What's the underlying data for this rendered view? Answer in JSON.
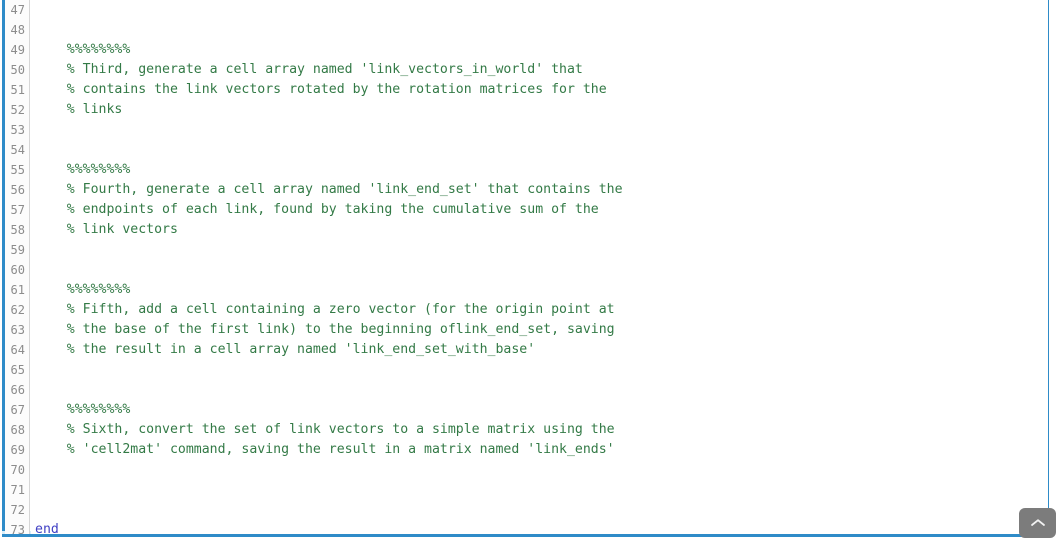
{
  "editor": {
    "language": "matlab",
    "first_visible_line": 47,
    "colors": {
      "comment": "#337a46",
      "keyword": "#4141c4",
      "plain": "#000000",
      "gutter_text": "#8c8c8c",
      "gutter_bg": "#fcfcfc",
      "focus_border": "#2e8bc8",
      "editor_bg": "#ffffff",
      "scroll_button_bg": "#7c7c7c"
    },
    "lines": [
      {
        "number": "47",
        "tokens": []
      },
      {
        "number": "48",
        "tokens": []
      },
      {
        "number": "49",
        "tokens": [
          {
            "type": "comment",
            "text": "    %%%%%%%%"
          }
        ]
      },
      {
        "number": "50",
        "tokens": [
          {
            "type": "comment",
            "text": "    % Third, generate a cell array named 'link_vectors_in_world' that"
          }
        ]
      },
      {
        "number": "51",
        "tokens": [
          {
            "type": "comment",
            "text": "    % contains the link vectors rotated by the rotation matrices for the"
          }
        ]
      },
      {
        "number": "52",
        "tokens": [
          {
            "type": "comment",
            "text": "    % links"
          }
        ]
      },
      {
        "number": "53",
        "tokens": []
      },
      {
        "number": "54",
        "tokens": []
      },
      {
        "number": "55",
        "tokens": [
          {
            "type": "comment",
            "text": "    %%%%%%%%"
          }
        ]
      },
      {
        "number": "56",
        "tokens": [
          {
            "type": "comment",
            "text": "    % Fourth, generate a cell array named 'link_end_set' that contains the"
          }
        ]
      },
      {
        "number": "57",
        "tokens": [
          {
            "type": "comment",
            "text": "    % endpoints of each link, found by taking the cumulative sum of the"
          }
        ]
      },
      {
        "number": "58",
        "tokens": [
          {
            "type": "comment",
            "text": "    % link vectors"
          }
        ]
      },
      {
        "number": "59",
        "tokens": []
      },
      {
        "number": "60",
        "tokens": []
      },
      {
        "number": "61",
        "tokens": [
          {
            "type": "comment",
            "text": "    %%%%%%%%"
          }
        ]
      },
      {
        "number": "62",
        "tokens": [
          {
            "type": "comment",
            "text": "    % Fifth, add a cell containing a zero vector (for the origin point at"
          }
        ]
      },
      {
        "number": "63",
        "tokens": [
          {
            "type": "comment",
            "text": "    % the base of the first link) to the beginning oflink_end_set, saving"
          }
        ]
      },
      {
        "number": "64",
        "tokens": [
          {
            "type": "comment",
            "text": "    % the result in a cell array named 'link_end_set_with_base'"
          }
        ]
      },
      {
        "number": "65",
        "tokens": []
      },
      {
        "number": "66",
        "tokens": []
      },
      {
        "number": "67",
        "tokens": [
          {
            "type": "comment",
            "text": "    %%%%%%%%"
          }
        ]
      },
      {
        "number": "68",
        "tokens": [
          {
            "type": "comment",
            "text": "    % Sixth, convert the set of link vectors to a simple matrix using the"
          }
        ]
      },
      {
        "number": "69",
        "tokens": [
          {
            "type": "comment",
            "text": "    % 'cell2mat' command, saving the result in a matrix named 'link_ends'"
          }
        ]
      },
      {
        "number": "70",
        "tokens": []
      },
      {
        "number": "71",
        "tokens": []
      },
      {
        "number": "72",
        "tokens": []
      },
      {
        "number": "73",
        "tokens": [
          {
            "type": "keyword",
            "text": "end"
          }
        ]
      }
    ]
  },
  "controls": {
    "scroll_to_top": {
      "icon": "chevron-up-icon",
      "label": ""
    }
  }
}
